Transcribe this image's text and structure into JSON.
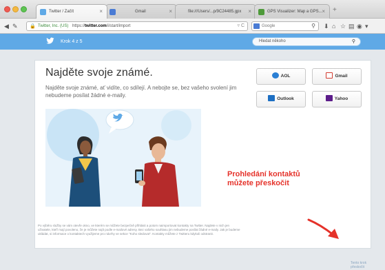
{
  "browser": {
    "tabs": [
      {
        "label": "Twitter / Začít",
        "active": true
      },
      {
        "label": "Gmail",
        "active": false
      },
      {
        "label": "file:///Users/...p/9C24485.gpx",
        "active": false
      },
      {
        "label": "GPS Visualizer: Map a GPS...",
        "active": false
      }
    ],
    "url_secure_label": "Twitter, Inc. (US)",
    "url_prefix": "https://",
    "url_domain": "twitter.com",
    "url_path": "/i/start/import",
    "search_engine": "Google"
  },
  "twitter": {
    "step_label": "Krok 4 z 5",
    "search_placeholder": "Hledat někoho"
  },
  "content": {
    "heading": "Najděte svoje známé.",
    "subtext": "Najděte svoje známé, ať vidíte, co sdílejí. A nebojte se, bez vašeho svolení jim nebudeme posílat žádné e-maily.",
    "providers": [
      {
        "name": "AOL",
        "icon": "aol-icon",
        "color": "#2a7fd4"
      },
      {
        "name": "Gmail",
        "icon": "gmail-icon",
        "color": "#d23b2f"
      },
      {
        "name": "Outlook",
        "icon": "outlook-icon",
        "color": "#1d6fc3"
      },
      {
        "name": "Yahoo",
        "icon": "yahoo-icon",
        "color": "#5c1d8a"
      }
    ],
    "skip_link": "Tento krok přeskočit",
    "annotation_line1": "Prohledání kontaktů",
    "annotation_line2": "můžete přeskočit",
    "footer": "Po výběru služby se vám otevře okno, ve kterém se můžete bezpečně přihlásit a potom naimportovat kontakty na Twitter. Najdete v nich jen uživatele, kteří mají povoleno, že je můžete najít podle e-mailové adresy. Bez vašeho souhlasu jim nebudeme posílat žádné e-maily. Jak je budeme ukládat, si informace o kontaktech využijeme pro návrhy ve sekce \"Koho sledovat\". Kontakty můžete z Twitteru kdykoli odstranit."
  },
  "colors": {
    "twitter_blue": "#5fa9e6",
    "annotation_red": "#e5322a"
  }
}
